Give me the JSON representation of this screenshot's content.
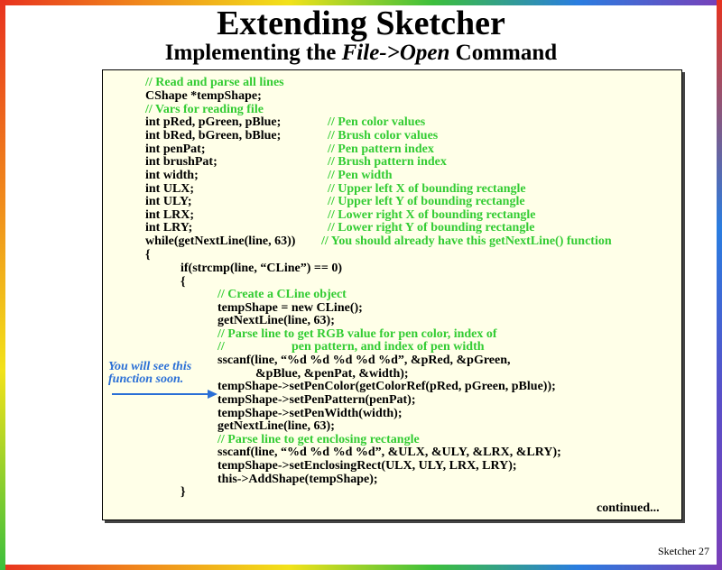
{
  "title": "Extending Sketcher",
  "subtitle": {
    "before": "Implementing the ",
    "emphasis": "File->Open",
    "after": " Command"
  },
  "code": {
    "lines": [
      {
        "text": "// Read and parse all lines",
        "comment": ""
      },
      {
        "text": "CShape *tempShape;",
        "comment": ""
      },
      {
        "text": "// Vars for reading file",
        "comment": ""
      },
      {
        "text": "int pRed, pGreen, pBlue;",
        "comment": "// Pen color values"
      },
      {
        "text": "int bRed, bGreen, bBlue;",
        "comment": "// Brush color values"
      },
      {
        "text": "int penPat;",
        "comment": "// Pen pattern index"
      },
      {
        "text": "int brushPat;",
        "comment": "// Brush pattern index"
      },
      {
        "text": "int width;",
        "comment": "// Pen width"
      },
      {
        "text": "int ULX;",
        "comment": "// Upper left X of bounding rectangle"
      },
      {
        "text": "int ULY;",
        "comment": "// Upper left Y of bounding rectangle"
      },
      {
        "text": "int LRX;",
        "comment": "// Lower right X of bounding rectangle"
      },
      {
        "text": "int LRY;",
        "comment": "// Lower right Y of bounding rectangle"
      },
      {
        "text": "while(getNextLine(line, 63))",
        "comment": "// You should already have this getNextLine() function"
      },
      {
        "text": "{",
        "comment": ""
      },
      {
        "text": "if(strcmp(line, “CLine”) == 0)",
        "comment": ""
      },
      {
        "text": "{",
        "comment": ""
      },
      {
        "text": "// Create a CLine object",
        "comment": ""
      },
      {
        "text": "tempShape = new CLine();",
        "comment": ""
      },
      {
        "text": "getNextLine(line, 63);",
        "comment": ""
      },
      {
        "text": "// Parse line to get RGB value for pen color, index of",
        "comment": ""
      },
      {
        "text": "//",
        "comment": "pen pattern, and index of pen width"
      },
      {
        "text": "sscanf(line, “%d %d %d %d %d”, &pRed, &pGreen,",
        "comment": ""
      },
      {
        "text": "&pBlue, &penPat, &width);",
        "comment": ""
      },
      {
        "text": "tempShape->setPenColor(getColorRef(pRed, pGreen, pBlue));",
        "comment": ""
      },
      {
        "text": "tempShape->setPenPattern(penPat);",
        "comment": ""
      },
      {
        "text": "tempShape->setPenWidth(width);",
        "comment": ""
      },
      {
        "text": "getNextLine(line, 63);",
        "comment": ""
      },
      {
        "text": "// Parse line to get enclosing rectangle",
        "comment": ""
      },
      {
        "text": "sscanf(line, “%d %d %d %d”, &ULX, &ULY, &LRX, &LRY);",
        "comment": ""
      },
      {
        "text": "tempShape->setEnclosingRect(ULX, ULY, LRX, LRY);",
        "comment": ""
      },
      {
        "text": "this->AddShape(tempShape);",
        "comment": ""
      },
      {
        "text": "}",
        "comment": ""
      }
    ],
    "continued": "continued..."
  },
  "callout": {
    "line1": "You will see this",
    "line2": "function soon."
  },
  "footer": "Sketcher 27",
  "colors": {
    "comment": "#33cc33",
    "callout": "#2a6fd6",
    "code_background": "#ffffe8"
  }
}
